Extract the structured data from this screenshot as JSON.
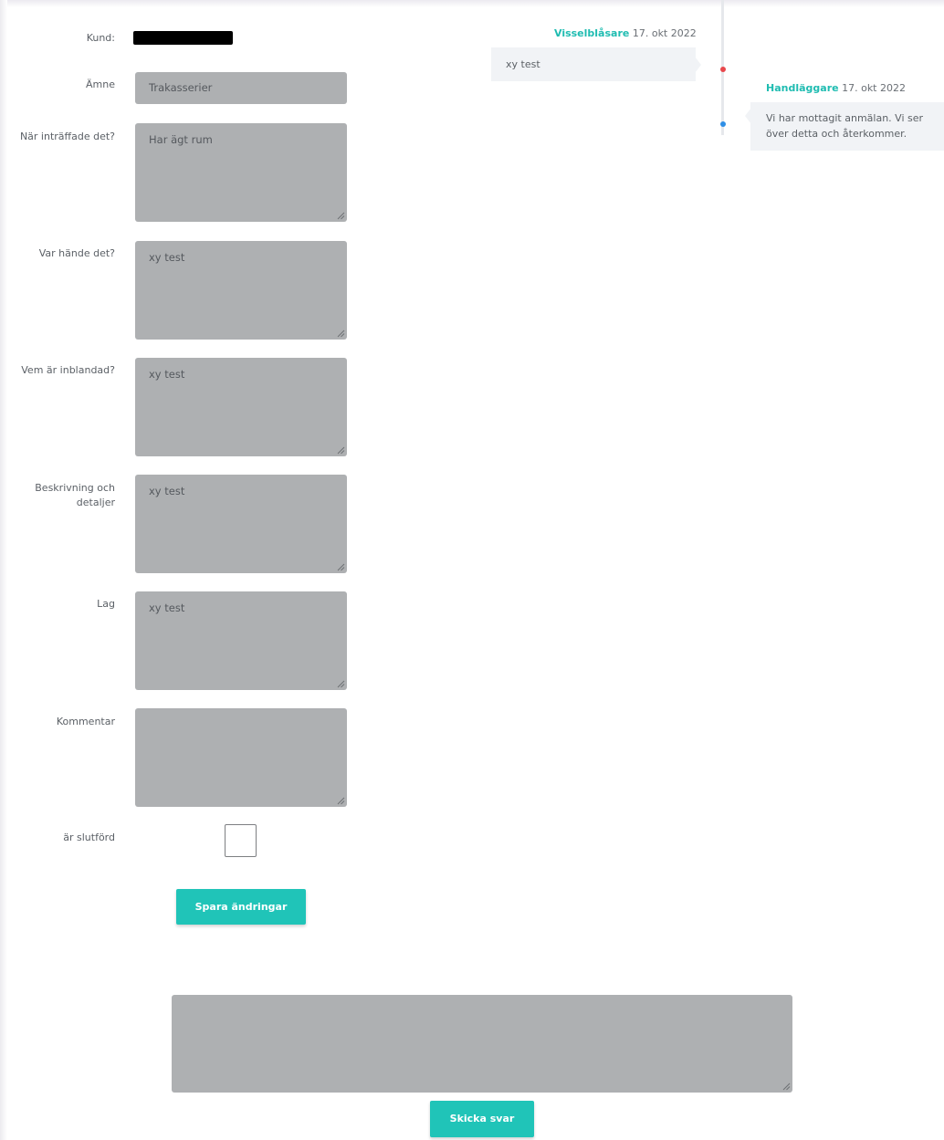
{
  "form": {
    "customer_label": "Kund:",
    "subject_label": "Ämne",
    "subject_value": "Trakasserier",
    "when_label": "När inträffade det?",
    "when_value": "Har ägt rum",
    "where_label": "Var hände det?",
    "where_value": "xy test",
    "who_label": "Vem är inblandad?",
    "who_value": "xy test",
    "description_label_line1": "Beskrivning och",
    "description_label_line2": "detaljer",
    "description_value": "xy test",
    "law_label": "Lag",
    "law_value": "xy test",
    "comment_label": "Kommentar",
    "comment_value": "",
    "completed_label": "är slutförd",
    "completed_checked": false,
    "save_button": "Spara ändringar"
  },
  "reply": {
    "textarea_value": "",
    "send_button": "Skicka svar"
  },
  "timeline": {
    "messages": [
      {
        "author": "Visselblåsare",
        "date": "17. okt 2022",
        "text": "xy test",
        "dot_color": "#e8474c"
      },
      {
        "author": "Handläggare",
        "date": "17. okt 2022",
        "text_line1": "Vi har mottagit anmälan. Vi ser",
        "text_line2": "över detta och återkommer.",
        "dot_color": "#2f8fe6"
      }
    ]
  },
  "colors": {
    "accent": "#20c4b8",
    "field_bg": "#aeb0b2"
  }
}
